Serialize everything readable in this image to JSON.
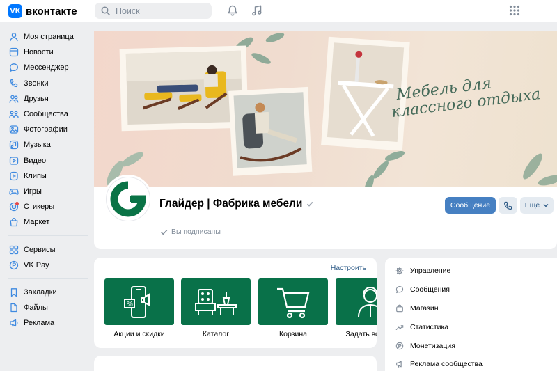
{
  "header": {
    "logo_text": "вконтакте",
    "logo_mark": "VK",
    "search_placeholder": "Поиск",
    "icons": [
      "bell-icon",
      "music-icon",
      "apps-grid-icon"
    ]
  },
  "sidebar": {
    "main": [
      {
        "label": "Моя страница",
        "icon": "user-icon"
      },
      {
        "label": "Новости",
        "icon": "news-icon"
      },
      {
        "label": "Мессенджер",
        "icon": "chat-icon"
      },
      {
        "label": "Звонки",
        "icon": "phone-icon"
      },
      {
        "label": "Друзья",
        "icon": "friends-icon"
      },
      {
        "label": "Сообщества",
        "icon": "communities-icon"
      },
      {
        "label": "Фотографии",
        "icon": "photo-icon"
      },
      {
        "label": "Музыка",
        "icon": "music-icon"
      },
      {
        "label": "Видео",
        "icon": "video-icon"
      },
      {
        "label": "Клипы",
        "icon": "clips-icon"
      },
      {
        "label": "Игры",
        "icon": "games-icon"
      },
      {
        "label": "Стикеры",
        "icon": "stickers-icon"
      },
      {
        "label": "Маркет",
        "icon": "market-icon"
      }
    ],
    "services": [
      {
        "label": "Сервисы",
        "icon": "services-icon"
      },
      {
        "label": "VK Pay",
        "icon": "vkpay-icon"
      }
    ],
    "extra": [
      {
        "label": "Закладки",
        "icon": "bookmark-icon"
      },
      {
        "label": "Файлы",
        "icon": "files-icon"
      },
      {
        "label": "Реклама",
        "icon": "ads-icon"
      }
    ]
  },
  "cover": {
    "slogan_line1": "Мебель для",
    "slogan_line2": "классного отдыха"
  },
  "profile": {
    "name": "Глайдер | Фабрика мебели",
    "subscribed": "Вы подписаны",
    "message_button": "Сообщение",
    "more_button": "Ещё",
    "avatar_letter": "G"
  },
  "tiles": {
    "configure": "Настроить",
    "items": [
      {
        "label": "Акции и скидки",
        "icon": "sale-phone-icon"
      },
      {
        "label": "Каталог",
        "icon": "catalog-furniture-icon"
      },
      {
        "label": "Корзина",
        "icon": "cart-icon"
      },
      {
        "label": "Задать вопрос",
        "icon": "support-person-icon"
      }
    ]
  },
  "management": [
    {
      "label": "Управление",
      "icon": "gear-icon"
    },
    {
      "label": "Сообщения",
      "icon": "message-icon"
    },
    {
      "label": "Магазин",
      "icon": "shop-bag-icon"
    },
    {
      "label": "Статистика",
      "icon": "stats-icon"
    },
    {
      "label": "Монетизация",
      "icon": "monetization-icon"
    },
    {
      "label": "Реклама сообщества",
      "icon": "megaphone-icon"
    }
  ],
  "colors": {
    "accent": "#4680c2",
    "brand_green": "#097149",
    "vk_blue": "#0077ff",
    "page_bg": "#edeef0"
  }
}
